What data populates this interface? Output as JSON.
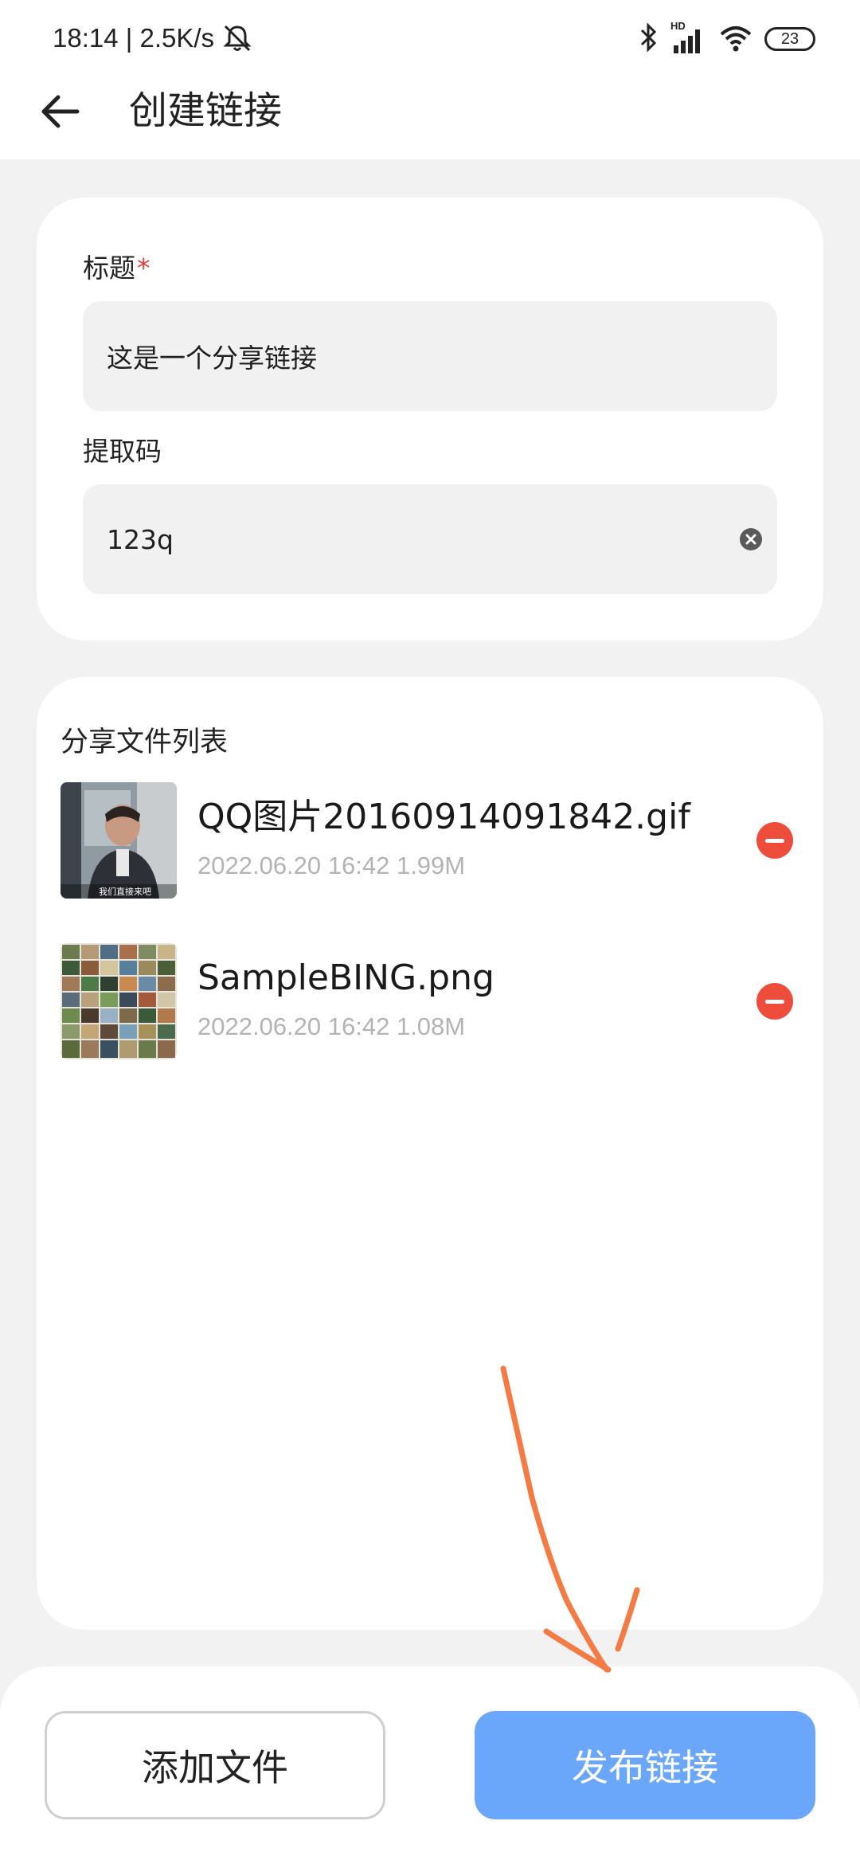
{
  "status_bar": {
    "time_speed": "18:14 | 2.5K/s",
    "battery": "23",
    "network_label": "HD"
  },
  "header": {
    "title": "创建链接"
  },
  "form": {
    "title_label": "标题",
    "required_mark": "*",
    "title_value": "这是一个分享链接",
    "code_label": "提取码",
    "code_value": "123q"
  },
  "files": {
    "list_title": "分享文件列表",
    "items": [
      {
        "name": "QQ图片20160914091842.gif",
        "meta": "2022.06.20 16:42 1.99M",
        "thumb_caption": "我们直接来吧"
      },
      {
        "name": "SampleBING.png",
        "meta": "2022.06.20 16:42 1.08M"
      }
    ]
  },
  "actions": {
    "add_label": "添加文件",
    "publish_label": "发布链接"
  },
  "colors": {
    "accent": "#6aa7fb",
    "danger": "#ef4d3c",
    "annotation": "#f47b43"
  }
}
